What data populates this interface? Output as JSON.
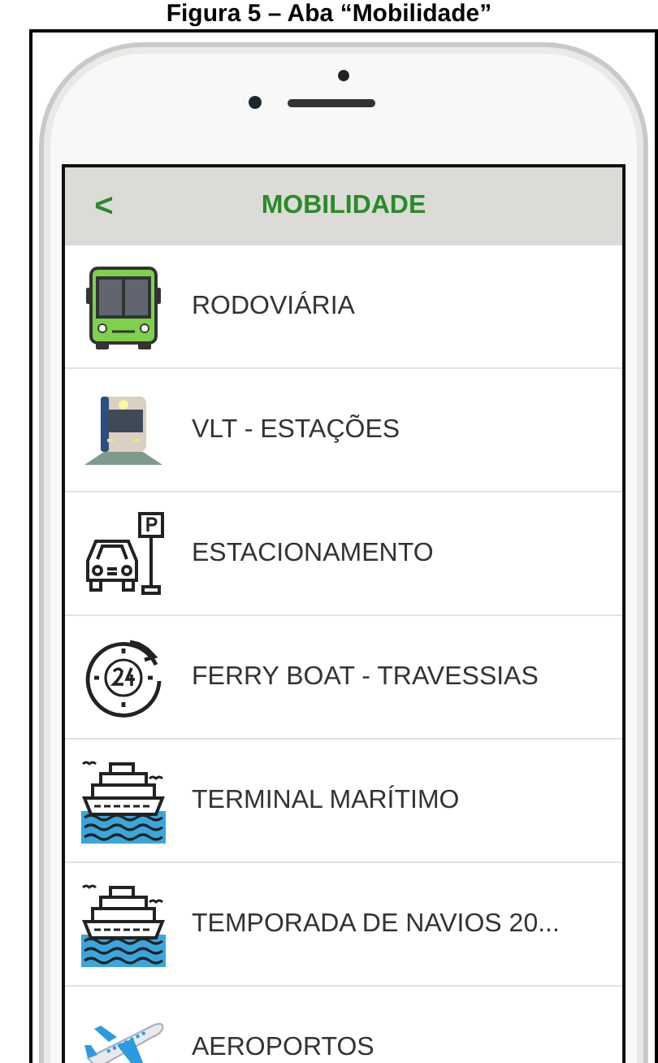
{
  "caption": "Figura 5 – Aba “Mobilidade”",
  "header": {
    "back": "<",
    "title": "MOBILIDADE"
  },
  "items": [
    {
      "kind": "bus",
      "label": "RODOVIÁRIA"
    },
    {
      "kind": "tram",
      "label": "VLT - ESTAÇÕES"
    },
    {
      "kind": "parking",
      "label": "ESTACIONAMENTO"
    },
    {
      "kind": "ferry",
      "label": "FERRY BOAT - TRAVESSIAS"
    },
    {
      "kind": "ship",
      "label": "TERMINAL MARÍTIMO"
    },
    {
      "kind": "ship",
      "label": "TEMPORADA DE NAVIOS 20..."
    },
    {
      "kind": "plane",
      "label": "AEROPORTOS"
    }
  ]
}
